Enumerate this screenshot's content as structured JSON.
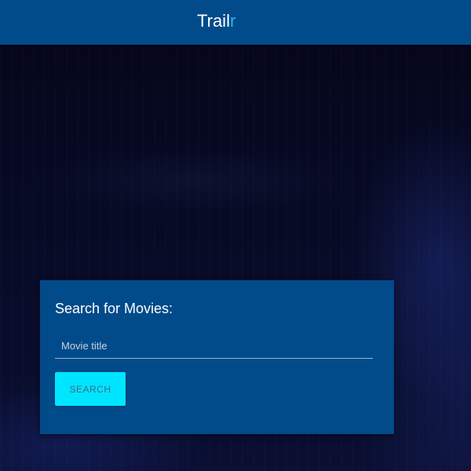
{
  "navbar": {
    "brand_main": "Trail",
    "brand_accent": "r"
  },
  "search_card": {
    "title": "Search for Movies:",
    "input_placeholder": "Movie title",
    "input_value": "",
    "button_label": "SEARCH"
  },
  "colors": {
    "navbar_bg": "#024b8a",
    "card_bg": "#024b8a",
    "brand_accent": "#29b6f6",
    "button_bg": "#00e5ff",
    "page_bg": "#06071f"
  }
}
